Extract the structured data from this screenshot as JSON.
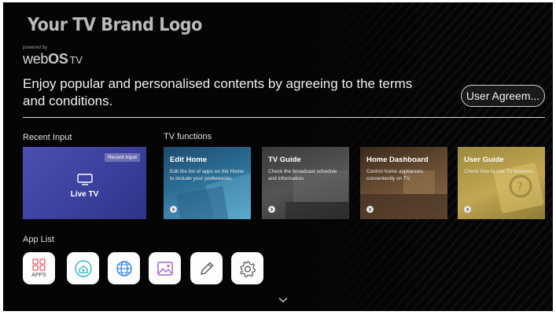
{
  "header": {
    "brand_logo": "Your TV Brand Logo",
    "powered_by": "powered by",
    "webos_web": "web",
    "webos_os": "OS",
    "webos_tv": "TV",
    "headline": "Enjoy popular and personalised contents by agreeing to the terms and conditions.",
    "agreement_button": "User Agreem..."
  },
  "recent_input": {
    "section_label": "Recent Input",
    "badge": "Recent Input",
    "label": "Live TV"
  },
  "tv_functions": {
    "section_label": "TV functions",
    "cards": [
      {
        "title": "Edit Home",
        "desc": "Edit the list of apps on the Home to include your preferences."
      },
      {
        "title": "TV Guide",
        "desc": "Check the broadcast schedule and information."
      },
      {
        "title": "Home Dashboard",
        "desc": "Control home appliances conveniently on TV."
      },
      {
        "title": "User Guide",
        "desc": "Check how to use TV features."
      }
    ]
  },
  "app_list": {
    "section_label": "App List",
    "apps_label": "APPS",
    "icons": [
      "apps-icon",
      "home-dashboard-icon",
      "browser-globe-icon",
      "media-gallery-icon",
      "edit-pencil-icon",
      "settings-gear-icon"
    ]
  },
  "colors": {
    "background": "#050505",
    "recent_card": "#4b4fb0",
    "apps_icon_accent": "#e0606a"
  }
}
